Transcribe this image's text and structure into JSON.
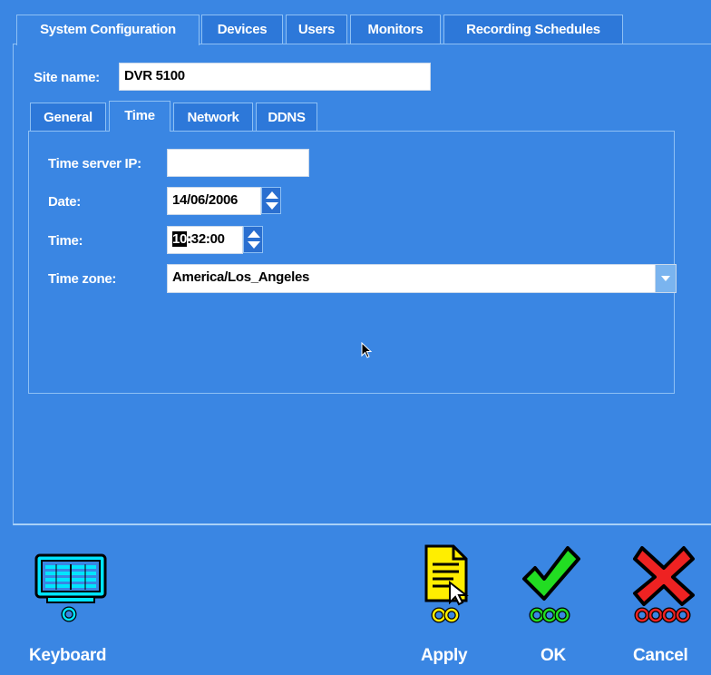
{
  "top_tabs": [
    "System Configuration",
    "Devices",
    "Users",
    "Monitors",
    "Recording Schedules"
  ],
  "site_name": {
    "label": "Site name:",
    "value": "DVR 5100"
  },
  "sub_tabs": [
    "General",
    "Time",
    "Network",
    "DDNS"
  ],
  "fields": {
    "time_server_label": "Time server IP:",
    "time_server_value": "",
    "date_label": "Date:",
    "date_value": "14/06/2006",
    "time_label": "Time:",
    "time_hour": "10",
    "time_rest": ":32:00",
    "timezone_label": "Time zone:",
    "timezone_value": "America/Los_Angeles"
  },
  "bottom": {
    "keyboard": "Keyboard",
    "apply": "Apply",
    "ok": "OK",
    "cancel": "Cancel"
  },
  "icons": {
    "keyboard": "keyboard-icon",
    "apply": "document-apply-icon",
    "ok": "checkmark-icon",
    "cancel": "x-cancel-icon",
    "cursor": "mouse-pointer-icon"
  },
  "colors": {
    "background": "#3a86e3",
    "keyboard_icon": "#00e5ff",
    "apply_icon": "#ffee00",
    "ok_icon": "#22dd22",
    "cancel_icon": "#ee2222"
  }
}
